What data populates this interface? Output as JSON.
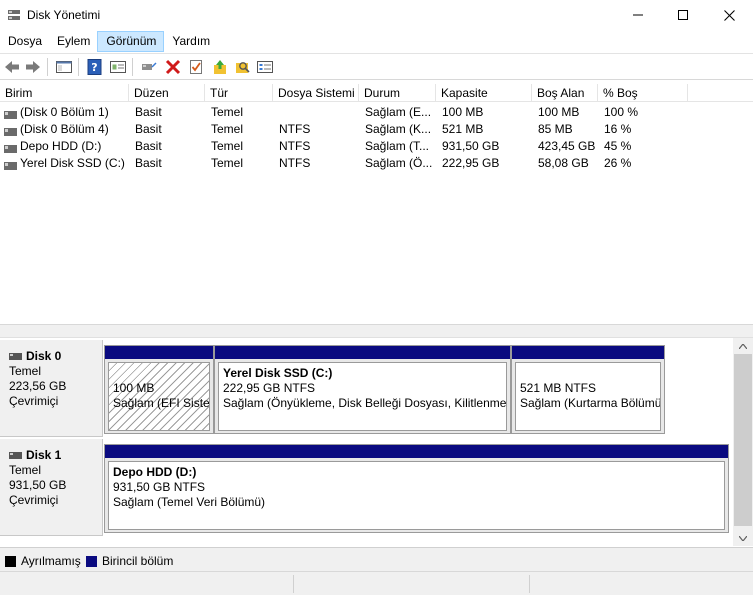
{
  "window": {
    "title": "Disk Yönetimi"
  },
  "menu": [
    "Dosya",
    "Eylem",
    "Görünüm",
    "Yardım"
  ],
  "menu_active_index": 2,
  "toolbar_icons": [
    "back-icon",
    "forward-icon",
    "console-tree-icon",
    "help-icon",
    "properties-icon",
    "connect-drive-icon",
    "delete-icon",
    "check-icon",
    "open-folder-up-icon",
    "search-folder-icon",
    "settings-list-icon"
  ],
  "table": {
    "columns": [
      "Birim",
      "Düzen",
      "Tür",
      "Dosya Sistemi",
      "Durum",
      "Kapasite",
      "Boş Alan",
      "% Boş"
    ],
    "rows": [
      [
        "(Disk 0 Bölüm 1)",
        "Basit",
        "Temel",
        "",
        "Sağlam (E...",
        "100 MB",
        "100 MB",
        "100 %"
      ],
      [
        "(Disk 0 Bölüm 4)",
        "Basit",
        "Temel",
        "NTFS",
        "Sağlam (K...",
        "521 MB",
        "85 MB",
        "16 %"
      ],
      [
        "Depo HDD (D:)",
        "Basit",
        "Temel",
        "NTFS",
        "Sağlam (T...",
        "931,50 GB",
        "423,45 GB",
        "45 %"
      ],
      [
        "Yerel Disk SSD (C:)",
        "Basit",
        "Temel",
        "NTFS",
        "Sağlam (Ö...",
        "222,95 GB",
        "58,08 GB",
        "26 %"
      ]
    ]
  },
  "disks": [
    {
      "name": "Disk 0",
      "type": "Temel",
      "size": "223,56 GB",
      "status": "Çevrimiçi",
      "partitions": [
        {
          "title": "",
          "size": "100 MB",
          "status": "Sağlam (EFI Sistem Bölümü)",
          "hatched": true
        },
        {
          "title": "Yerel Disk SSD  (C:)",
          "size": "222,95 GB NTFS",
          "status": "Sağlam (Önyükleme, Disk Belleği Dosyası, Kilitlenme Bilgi Dökümü, Birincil Bölüm)"
        },
        {
          "title": "",
          "size": "521 MB NTFS",
          "status": "Sağlam (Kurtarma Bölümü)"
        }
      ]
    },
    {
      "name": "Disk 1",
      "type": "Temel",
      "size": "931,50 GB",
      "status": "Çevrimiçi",
      "partitions": [
        {
          "title": "Depo HDD  (D:)",
          "size": "931,50 GB NTFS",
          "status": "Sağlam (Temel Veri Bölümü)"
        }
      ]
    }
  ],
  "legend": [
    {
      "label": "Ayrılmamış",
      "color": "#000000"
    },
    {
      "label": "Birincil bölüm",
      "color": "#0a0a80"
    }
  ]
}
